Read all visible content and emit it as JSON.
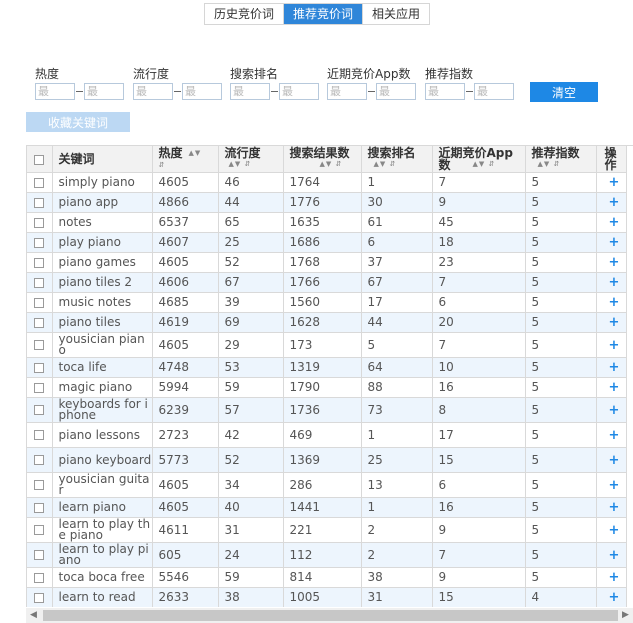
{
  "tabs": [
    {
      "label": "历史竞价词",
      "active": false
    },
    {
      "label": "推荐竞价词",
      "active": true
    },
    {
      "label": "相关应用",
      "active": false
    }
  ],
  "filters": [
    {
      "label": "热度",
      "min_placeholder": "最",
      "max_placeholder": "最"
    },
    {
      "label": "流行度",
      "min_placeholder": "最",
      "max_placeholder": "最"
    },
    {
      "label": "搜索排名",
      "min_placeholder": "最",
      "max_placeholder": "最"
    },
    {
      "label": "近期竞价App数",
      "min_placeholder": "最",
      "max_placeholder": "最"
    },
    {
      "label": "推荐指数",
      "min_placeholder": "最",
      "max_placeholder": "最"
    }
  ],
  "buttons": {
    "clear": "清空",
    "collect": "收藏关键词"
  },
  "table": {
    "columns": [
      "关键词",
      "热度",
      "流行度",
      "搜索结果数",
      "搜索排名",
      "近期竞价App数",
      "推荐指数",
      "操作"
    ],
    "action_symbol": "+",
    "rows": [
      [
        "simply piano",
        "4605",
        "46",
        "1764",
        "1",
        "7",
        "5"
      ],
      [
        "piano app",
        "4866",
        "44",
        "1776",
        "30",
        "9",
        "5"
      ],
      [
        "notes",
        "6537",
        "65",
        "1635",
        "61",
        "45",
        "5"
      ],
      [
        "play piano",
        "4607",
        "25",
        "1686",
        "6",
        "18",
        "5"
      ],
      [
        "piano games",
        "4605",
        "52",
        "1768",
        "37",
        "23",
        "5"
      ],
      [
        "piano tiles 2",
        "4606",
        "67",
        "1766",
        "67",
        "7",
        "5"
      ],
      [
        "music notes",
        "4685",
        "39",
        "1560",
        "17",
        "6",
        "5"
      ],
      [
        "piano tiles",
        "4619",
        "69",
        "1628",
        "44",
        "20",
        "5"
      ],
      [
        "yousician piano",
        "4605",
        "29",
        "173",
        "5",
        "7",
        "5"
      ],
      [
        "toca life",
        "4748",
        "53",
        "1319",
        "64",
        "10",
        "5"
      ],
      [
        "magic piano",
        "5994",
        "59",
        "1790",
        "88",
        "16",
        "5"
      ],
      [
        "keyboards for iphone",
        "6239",
        "57",
        "1736",
        "73",
        "8",
        "5"
      ],
      [
        "piano lessons",
        "2723",
        "42",
        "469",
        "1",
        "17",
        "5"
      ],
      [
        "piano keyboard",
        "5773",
        "52",
        "1369",
        "25",
        "15",
        "5"
      ],
      [
        "yousician guitar",
        "4605",
        "34",
        "286",
        "13",
        "6",
        "5"
      ],
      [
        "learn piano",
        "4605",
        "40",
        "1441",
        "1",
        "16",
        "5"
      ],
      [
        "learn to play the piano",
        "4611",
        "31",
        "221",
        "2",
        "9",
        "5"
      ],
      [
        "learn to play piano",
        "605",
        "24",
        "112",
        "2",
        "7",
        "5"
      ],
      [
        "toca boca free",
        "5546",
        "59",
        "814",
        "38",
        "9",
        "5"
      ],
      [
        "learn to read",
        "2633",
        "38",
        "1005",
        "31",
        "15",
        "4"
      ]
    ]
  }
}
